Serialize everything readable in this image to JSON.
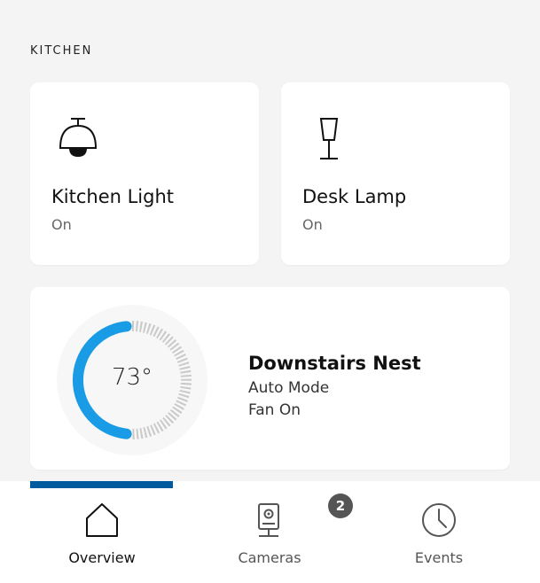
{
  "section": {
    "label": "KITCHEN"
  },
  "devices": [
    {
      "name": "Kitchen Light",
      "state": "On",
      "icon": "ceiling-light-icon"
    },
    {
      "name": "Desk Lamp",
      "state": "On",
      "icon": "desk-lamp-icon"
    }
  ],
  "thermostat": {
    "name": "Downstairs Nest",
    "temperature": "73°",
    "mode": "Auto Mode",
    "fan": "Fan On",
    "setpoint_fraction": 0.5,
    "accent_color": "#1a9be6"
  },
  "tabs": [
    {
      "label": "Overview",
      "icon": "house-icon",
      "active": true
    },
    {
      "label": "Cameras",
      "icon": "camera-icon",
      "badge": "2"
    },
    {
      "label": "Events",
      "icon": "clock-icon"
    }
  ],
  "colors": {
    "background": "#f4f4f4",
    "tab_indicator": "#005a9e",
    "badge": "#555555"
  }
}
